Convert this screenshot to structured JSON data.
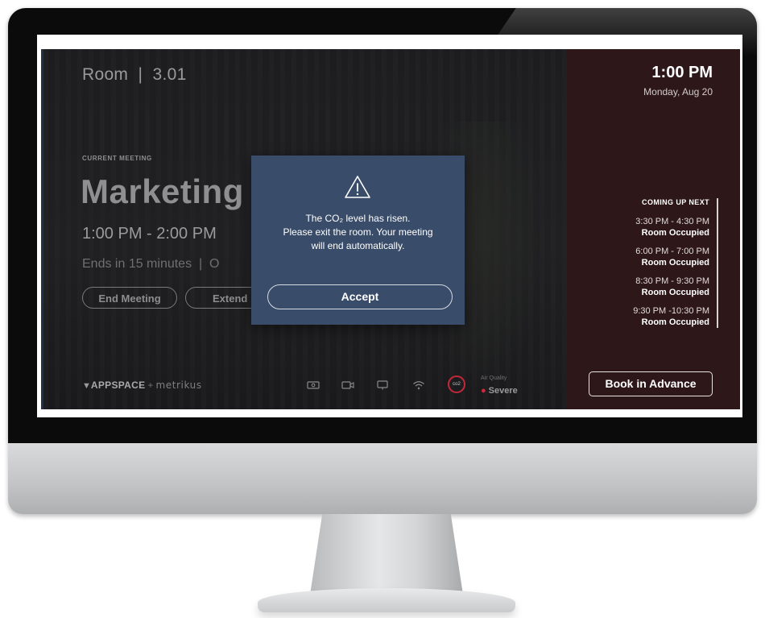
{
  "room": {
    "title": "Room  |  3.01"
  },
  "meeting": {
    "section_label": "CURRENT MEETING",
    "name": "Marketing",
    "time": "1:00 PM - 2:00 PM",
    "ends": "Ends in 15 minutes  |  O",
    "end_button": "End Meeting",
    "extend_button": "Extend"
  },
  "branding": {
    "appspace": "APPSPACE",
    "plus": "+",
    "metrikus": "metrikus"
  },
  "status_bar": {
    "icons": [
      "projector-icon",
      "camera-icon",
      "display-icon",
      "wifi-icon"
    ],
    "co2_label": "co2",
    "air_quality_label": "Air Quality",
    "air_quality_value": "Severe",
    "severity_color": "#d0283e"
  },
  "side_panel": {
    "clock": "1:00 PM",
    "date": "Monday, Aug 20",
    "coming_up_title": "COMING UP NEXT",
    "slots": [
      {
        "time": "3:30 PM - 4:30 PM",
        "status": "Room Occupied"
      },
      {
        "time": "6:00 PM - 7:00 PM",
        "status": "Room Occupied"
      },
      {
        "time": "8:30 PM - 9:30 PM",
        "status": "Room Occupied"
      },
      {
        "time": "9:30 PM -10:30 PM",
        "status": "Room Occupied"
      }
    ],
    "book_button": "Book in Advance",
    "panel_color": "#2d1719"
  },
  "modal": {
    "line1": "The CO₂ level has risen.",
    "line2": "Please exit the room. Your meeting",
    "line3": "will end automatically.",
    "accept_button": "Accept",
    "background_color": "#394c69"
  }
}
